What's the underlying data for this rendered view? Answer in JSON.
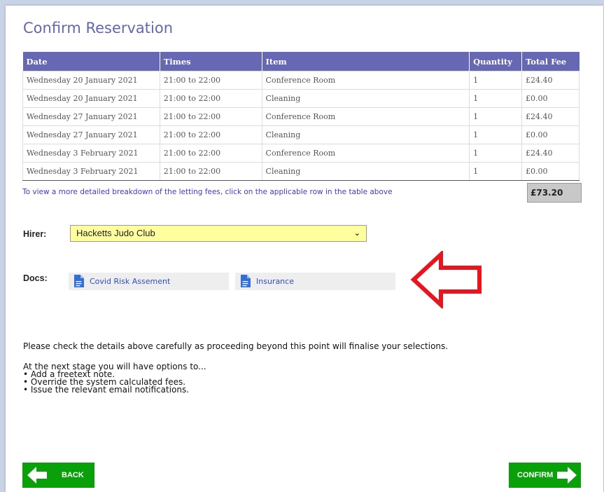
{
  "page": {
    "title": "Confirm Reservation"
  },
  "table": {
    "headers": [
      "Date",
      "Times",
      "Item",
      "Quantity",
      "Total Fee"
    ],
    "rows": [
      [
        "Wednesday 20 January 2021",
        "21:00 to 22:00",
        "Conference Room",
        "1",
        "£24.40"
      ],
      [
        "Wednesday 20 January 2021",
        "21:00 to 22:00",
        "Cleaning",
        "1",
        "£0.00"
      ],
      [
        "Wednesday 27 January 2021",
        "21:00 to 22:00",
        "Conference Room",
        "1",
        "£24.40"
      ],
      [
        "Wednesday 27 January 2021",
        "21:00 to 22:00",
        "Cleaning",
        "1",
        "£0.00"
      ],
      [
        "Wednesday 3 February 2021",
        "21:00 to 22:00",
        "Conference Room",
        "1",
        "£24.40"
      ],
      [
        "Wednesday 3 February 2021",
        "21:00 to 22:00",
        "Cleaning",
        "1",
        "£0.00"
      ]
    ],
    "breakdown_note": "To view a more detailed breakdown of the letting fees, click on the applicable row in the table above",
    "total": "£73.20"
  },
  "hirer": {
    "label": "Hirer:",
    "selected": "Hacketts Judo Club"
  },
  "docs": {
    "label": "Docs:",
    "items": [
      "Covid Risk Assement",
      "Insurance"
    ]
  },
  "message": {
    "warning": "Please check the details above carefully as proceeding beyond this point will finalise your selections.",
    "options_intro": "At the next stage you will have options to...",
    "options": [
      "• Add a freetext note.",
      "• Override the system calculated fees.",
      "• Issue the relevant email notifications."
    ]
  },
  "buttons": {
    "back": "BACK",
    "confirm": "CONFIRM"
  },
  "colors": {
    "header": "#6668b3",
    "title": "#6566b0",
    "button": "#0aa00a",
    "select_bg": "#ffff9e",
    "arrow": "#e8141e"
  },
  "icons": {
    "doc": "document-icon",
    "back": "arrow-left-icon",
    "confirm": "arrow-right-icon",
    "callout": "arrow-left-outline-icon"
  }
}
